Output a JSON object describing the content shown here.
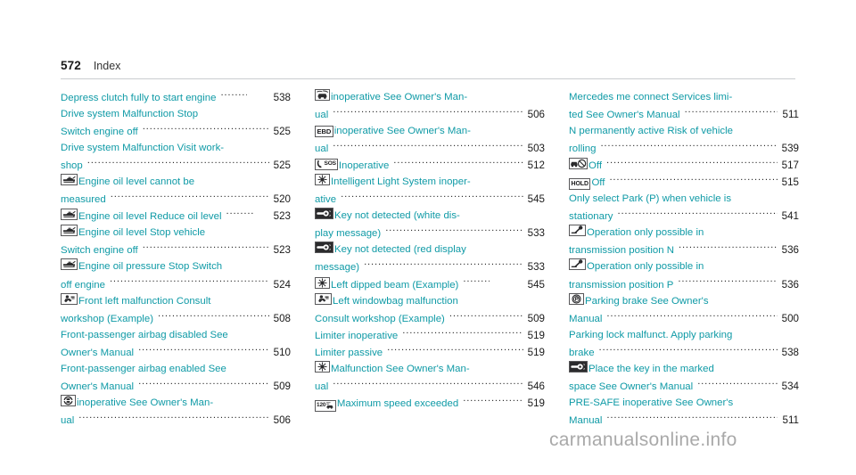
{
  "header": {
    "page_number": "572",
    "title": "Index"
  },
  "watermark": "carmanualsonline.info",
  "colors": {
    "entry_text": "#0f9aa6",
    "page_number": "#1a1a1a",
    "leader_dots": "#2a2a2a",
    "rule": "#c9cdd0",
    "watermark": "#a9a9a9"
  },
  "columns": [
    {
      "entries": [
        {
          "icon": null,
          "lines": [
            {
              "text": "Depress clutch fully to start engine",
              "leader": "short",
              "page": "538"
            },
            {
              "text": "Drive system Malfunction Stop",
              "leader": "none",
              "page": ""
            },
            {
              "text": "Switch engine off",
              "leader": "long",
              "page": "525"
            }
          ]
        },
        {
          "icon": null,
          "lines": [
            {
              "text": "Drive system Malfunction Visit work-",
              "leader": "none",
              "page": ""
            },
            {
              "text": "shop",
              "leader": "long",
              "page": "525"
            }
          ]
        },
        {
          "icon": "oil-can-icon",
          "lines": [
            {
              "text": "Engine oil level cannot be",
              "leader": "none",
              "page": ""
            },
            {
              "text": "measured",
              "leader": "long",
              "page": "520"
            }
          ]
        },
        {
          "icon": "oil-can-icon",
          "lines": [
            {
              "text": "Engine oil level Reduce oil level",
              "leader": "short",
              "page": "523"
            }
          ]
        },
        {
          "icon": "oil-can-icon",
          "lines": [
            {
              "text": "Engine oil level Stop vehicle",
              "leader": "none",
              "page": ""
            },
            {
              "text": "Switch engine off",
              "leader": "long",
              "page": "523"
            }
          ]
        },
        {
          "icon": "oil-can-icon",
          "lines": [
            {
              "text": "Engine oil pressure Stop Switch",
              "leader": "none",
              "page": ""
            },
            {
              "text": "off engine",
              "leader": "long",
              "page": "524"
            }
          ]
        },
        {
          "icon": "airbag-person-icon",
          "lines": [
            {
              "text": "Front left malfunction Consult",
              "leader": "none",
              "page": ""
            },
            {
              "text": "workshop (Example)",
              "leader": "long",
              "page": "508"
            }
          ]
        },
        {
          "icon": null,
          "lines": [
            {
              "text": "Front-passenger airbag disabled See",
              "leader": "none",
              "page": ""
            },
            {
              "text": "Owner's Manual",
              "leader": "long",
              "page": "510"
            }
          ]
        },
        {
          "icon": null,
          "lines": [
            {
              "text": "Front-passenger airbag enabled See",
              "leader": "none",
              "page": ""
            },
            {
              "text": "Owner's Manual",
              "leader": "long",
              "page": "509"
            }
          ]
        },
        {
          "icon": "brake-disc-icon",
          "lines": [
            {
              "text": "inoperative See Owner's Man-",
              "leader": "none",
              "page": ""
            },
            {
              "text": "ual",
              "leader": "long",
              "page": "506"
            }
          ]
        }
      ]
    },
    {
      "entries": [
        {
          "icon": "esp-vehicle-icon",
          "lines": [
            {
              "text": "inoperative See Owner's Man-",
              "leader": "none",
              "page": ""
            },
            {
              "text": "ual",
              "leader": "long",
              "page": "506"
            }
          ]
        },
        {
          "icon": "ebd-text-icon",
          "icon_label": "EBD",
          "lines": [
            {
              "text": "inoperative See Owner's Man-",
              "leader": "none",
              "page": ""
            },
            {
              "text": "ual",
              "leader": "long",
              "page": "503"
            }
          ]
        },
        {
          "icon": "sos-phone-icon",
          "lines": [
            {
              "text": "Inoperative",
              "leader": "long",
              "page": "512"
            }
          ]
        },
        {
          "icon": "headlight-icon",
          "lines": [
            {
              "text": "Intelligent Light System inoper-",
              "leader": "none",
              "page": ""
            },
            {
              "text": "ative",
              "leader": "long",
              "page": "545"
            }
          ]
        },
        {
          "icon": "key-icon",
          "lines": [
            {
              "text": "Key not detected   (white dis-",
              "leader": "none",
              "page": ""
            },
            {
              "text": "play message)",
              "leader": "long",
              "page": "533"
            }
          ]
        },
        {
          "icon": "key-icon",
          "lines": [
            {
              "text": "Key not detected  (red display",
              "leader": "none",
              "page": ""
            },
            {
              "text": "message)",
              "leader": "long",
              "page": "533"
            }
          ]
        },
        {
          "icon": "headlight-icon",
          "lines": [
            {
              "text": "Left dipped beam (Example)",
              "leader": "short",
              "page": "545"
            }
          ]
        },
        {
          "icon": "airbag-person-icon",
          "lines": [
            {
              "text": "Left windowbag malfunction",
              "leader": "none",
              "page": ""
            },
            {
              "text": "Consult workshop (Example)",
              "leader": "long",
              "page": "509"
            }
          ]
        },
        {
          "icon": null,
          "lines": [
            {
              "text": "Limiter inoperative",
              "leader": "long",
              "page": "519"
            }
          ]
        },
        {
          "icon": null,
          "lines": [
            {
              "text": "Limiter passive",
              "leader": "long",
              "page": "519"
            }
          ]
        },
        {
          "icon": "headlight-icon",
          "lines": [
            {
              "text": "Malfunction See Owner's Man-",
              "leader": "none",
              "page": ""
            },
            {
              "text": "ual",
              "leader": "long",
              "page": "546"
            }
          ]
        },
        {
          "icon": "speed-limit-icon",
          "icon_label": "120",
          "lines": [
            {
              "text": "Maximum speed exceeded",
              "leader": "long",
              "page": "519"
            }
          ]
        }
      ]
    },
    {
      "entries": [
        {
          "icon": null,
          "lines": [
            {
              "text": "Mercedes me connect Services limi-",
              "leader": "none",
              "page": ""
            },
            {
              "text": "ted See Owner's Manual",
              "leader": "long",
              "page": "511"
            }
          ]
        },
        {
          "icon": null,
          "lines": [
            {
              "text": "N permanently active Risk of vehicle",
              "leader": "none",
              "page": ""
            },
            {
              "text": "rolling",
              "leader": "long",
              "page": "539"
            }
          ]
        },
        {
          "icon": "distance-warn-icon",
          "lines": [
            {
              "text": "Off",
              "leader": "long",
              "page": "517"
            }
          ]
        },
        {
          "icon": "hold-text-icon",
          "icon_label": "HOLD",
          "lines": [
            {
              "text": "Off",
              "leader": "long",
              "page": "515"
            }
          ]
        },
        {
          "icon": null,
          "lines": [
            {
              "text": "Only select Park (P) when vehicle is",
              "leader": "none",
              "page": ""
            },
            {
              "text": "stationary",
              "leader": "long",
              "page": "541"
            }
          ]
        },
        {
          "icon": "selector-lever-icon",
          "lines": [
            {
              "text": "Operation only possible in",
              "leader": "none",
              "page": ""
            },
            {
              "text": "transmission position N",
              "leader": "long",
              "page": "536"
            }
          ]
        },
        {
          "icon": "selector-lever-icon",
          "lines": [
            {
              "text": "Operation only possible in",
              "leader": "none",
              "page": ""
            },
            {
              "text": "transmission position P",
              "leader": "long",
              "page": "536"
            }
          ]
        },
        {
          "icon": "parking-brake-icon",
          "lines": [
            {
              "text": "Parking brake See Owner's",
              "leader": "none",
              "page": ""
            },
            {
              "text": "Manual",
              "leader": "long",
              "page": "500"
            }
          ]
        },
        {
          "icon": null,
          "lines": [
            {
              "text": "Parking lock malfunct. Apply parking",
              "leader": "none",
              "page": ""
            },
            {
              "text": "brake",
              "leader": "long",
              "page": "538"
            }
          ]
        },
        {
          "icon": "key-icon",
          "lines": [
            {
              "text": "Place the key in the marked",
              "leader": "none",
              "page": ""
            },
            {
              "text": "space See Owner's Manual",
              "leader": "long",
              "page": "534"
            }
          ]
        },
        {
          "icon": null,
          "lines": [
            {
              "text": "PRE-SAFE inoperative See Owner's",
              "leader": "none",
              "page": ""
            },
            {
              "text": "Manual",
              "leader": "long",
              "page": "511"
            }
          ]
        }
      ]
    }
  ]
}
